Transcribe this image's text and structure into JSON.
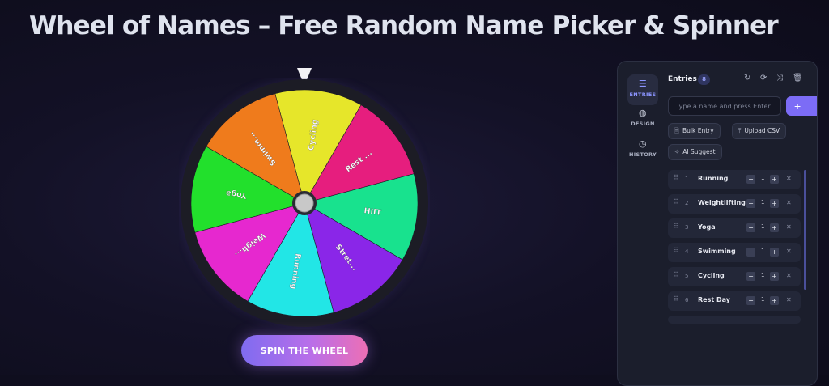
{
  "page": {
    "title": "Wheel of Names – Free Random Name Picker & Spinner"
  },
  "wheel": {
    "segments": [
      {
        "label": "Cycling",
        "color": "#e6e62a"
      },
      {
        "label": "Rest ...",
        "color": "#e61e7e"
      },
      {
        "label": "HIIT",
        "color": "#18e28e"
      },
      {
        "label": "Stret...",
        "color": "#8a26e8"
      },
      {
        "label": "Running",
        "color": "#22e6e6"
      },
      {
        "label": "Weigh...",
        "color": "#e628cf"
      },
      {
        "label": "Yoga",
        "color": "#22e02c"
      },
      {
        "label": "Swimm...",
        "color": "#ef7b1c"
      }
    ],
    "rim_color": "#1c1c25",
    "hub_color": "#c8c8c8"
  },
  "spin_button": {
    "label": "SPIN THE WHEEL"
  },
  "sidebar": {
    "items": [
      {
        "label": "ENTRIES",
        "icon": "list-icon"
      },
      {
        "label": "DESIGN",
        "icon": "palette-icon"
      },
      {
        "label": "HISTORY",
        "icon": "clock-icon"
      }
    ]
  },
  "entries_panel": {
    "title": "Entries",
    "count": "8",
    "input_placeholder": "Type a name and press Enter...",
    "add_label": "+",
    "bulk_label": "Bulk Entry",
    "upload_label": "Upload CSV",
    "ai_label": "AI Suggest",
    "items": [
      {
        "index": "1",
        "name": "Running",
        "qty": "1"
      },
      {
        "index": "2",
        "name": "Weightlifting",
        "qty": "1"
      },
      {
        "index": "3",
        "name": "Yoga",
        "qty": "1"
      },
      {
        "index": "4",
        "name": "Swimming",
        "qty": "1"
      },
      {
        "index": "5",
        "name": "Cycling",
        "qty": "1"
      },
      {
        "index": "6",
        "name": "Rest Day",
        "qty": "1"
      }
    ]
  }
}
